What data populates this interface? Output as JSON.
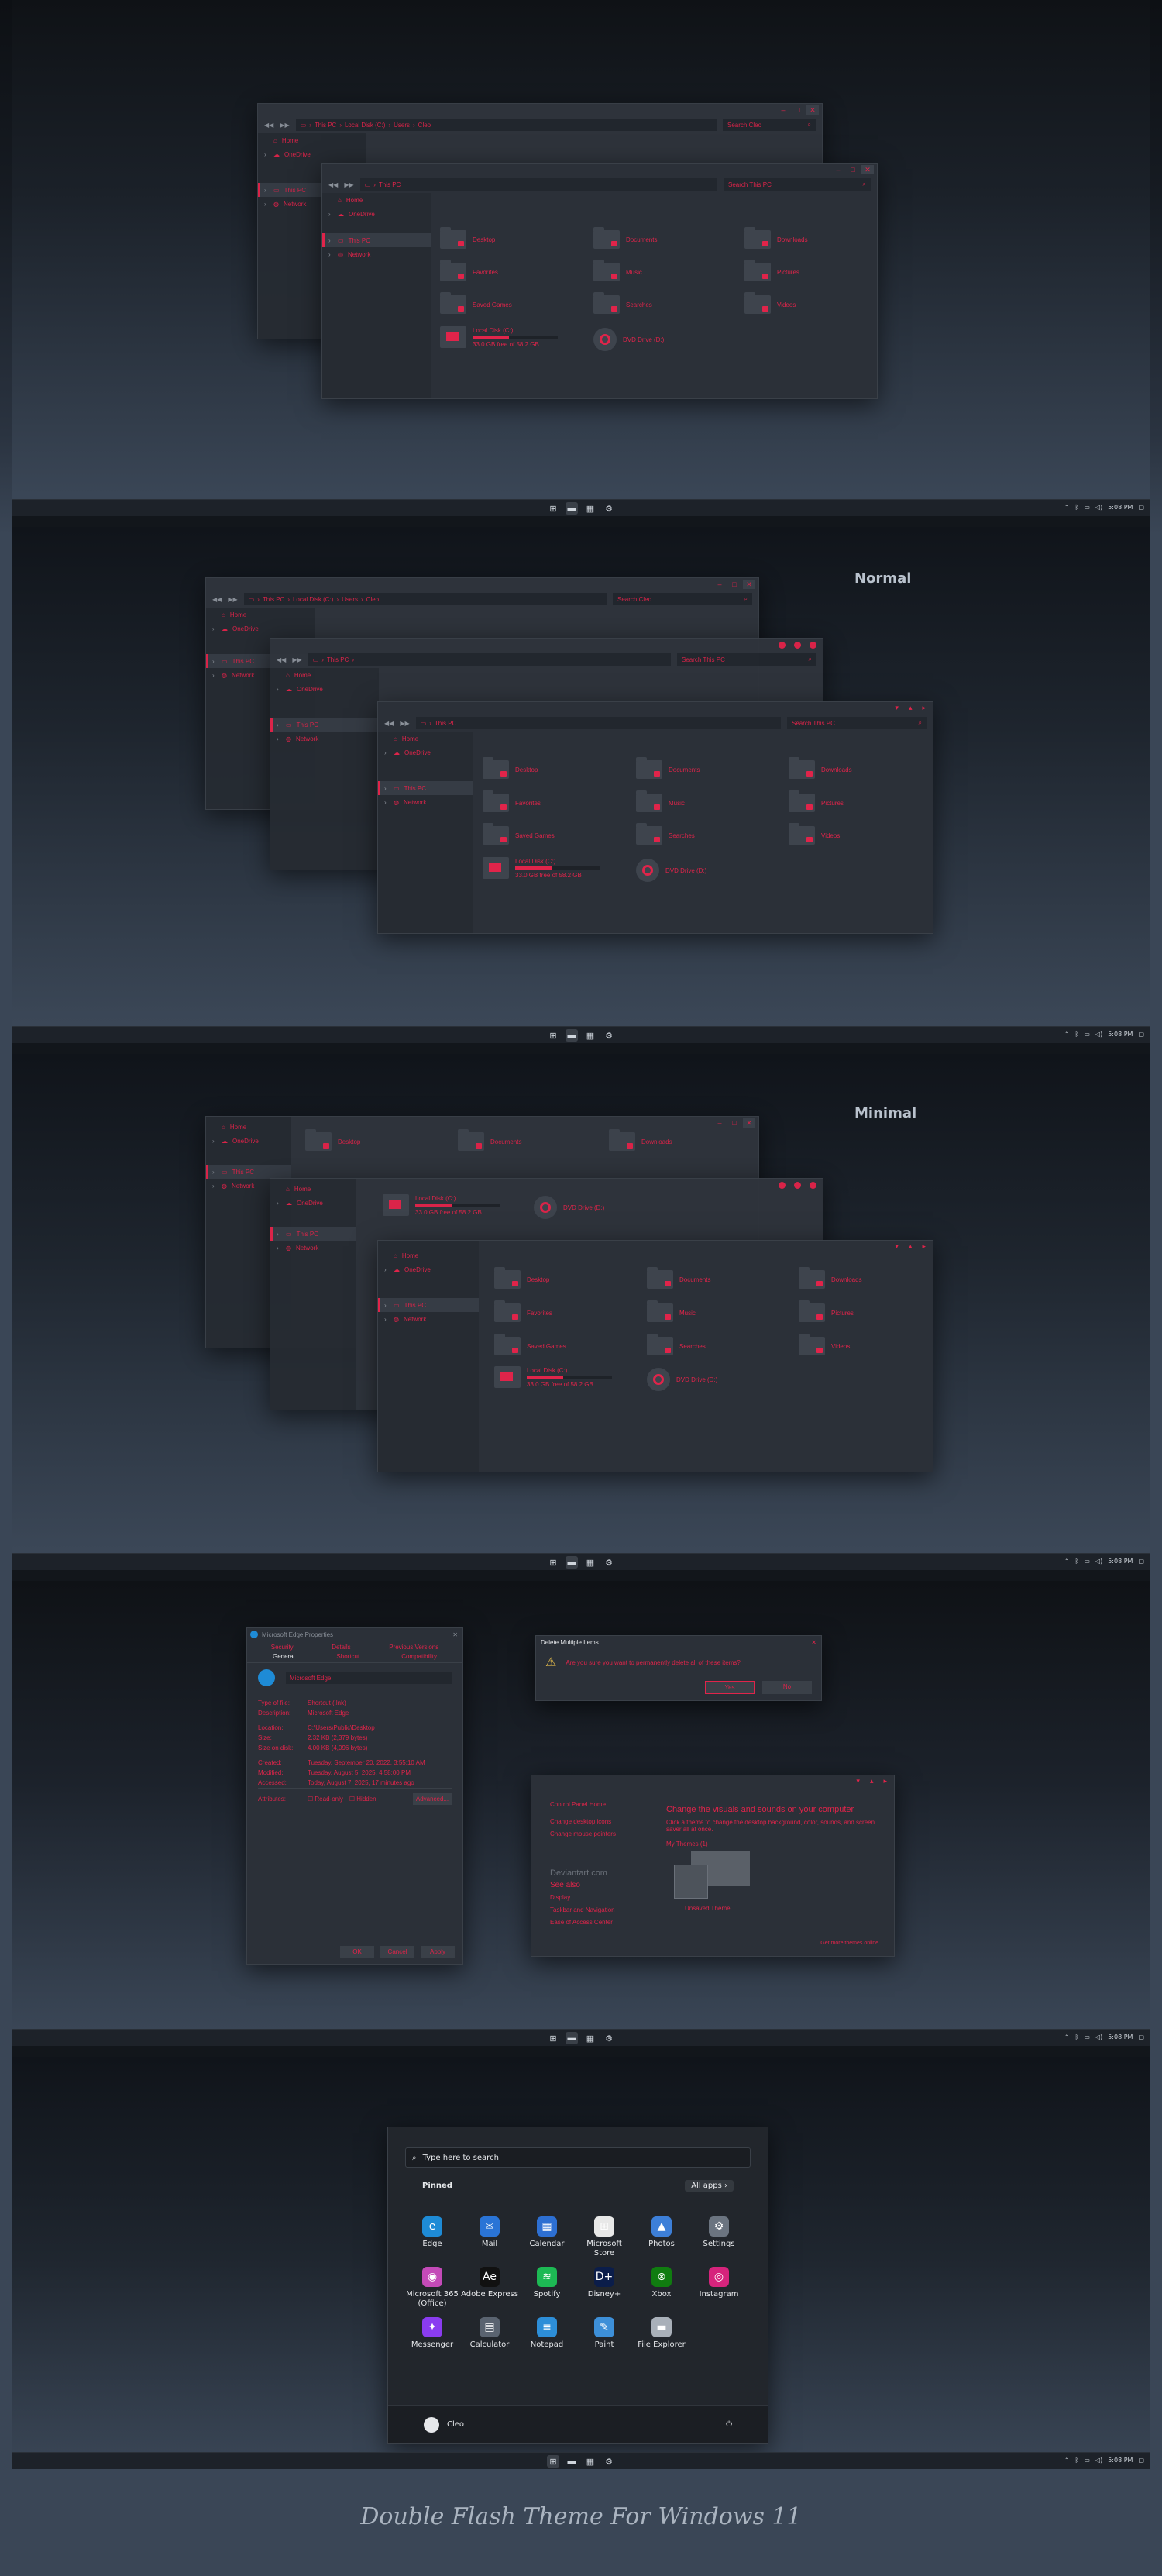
{
  "colors": {
    "accent": "#e0244a",
    "window": "#2b3038",
    "taskbar": "#1d2229",
    "text_light": "#e6e8eb"
  },
  "icons": {
    "taskbar": [
      "start-icon",
      "explorer-icon",
      "store-icon",
      "settings-icon"
    ],
    "tray": [
      "chevron-up-icon",
      "bluetooth-icon",
      "network-icon",
      "volume-icon",
      "notification-icon"
    ]
  },
  "taskbar": {
    "time": "5:08 PM"
  },
  "explorer": {
    "path_users": [
      "This PC",
      "Local Disk (C:)",
      "Users",
      "Cleo"
    ],
    "path_pc": [
      "This PC"
    ],
    "search_users": "Search Cleo",
    "search_pc": "Search This PC",
    "nav": {
      "home": "Home",
      "onedrive": "OneDrive",
      "thispc": "This PC",
      "network": "Network"
    },
    "folders": [
      "Desktop",
      "Documents",
      "Downloads",
      "Favorites",
      "Music",
      "Pictures",
      "Saved Games",
      "Searches",
      "Videos"
    ],
    "drive_c": {
      "name": "Local Disk (C:)",
      "free": "33.0 GB free of 58.2 GB",
      "used_fraction": 0.43
    },
    "drive_d": {
      "name": "DVD Drive (D:)"
    }
  },
  "labels": {
    "normal": "Normal",
    "minimal": "Minimal"
  },
  "props": {
    "title": "Microsoft Edge Properties",
    "tabs_top": [
      "Security",
      "Details",
      "Previous Versions"
    ],
    "tabs_bottom": [
      "General",
      "Shortcut",
      "Compatibility"
    ],
    "name": "Microsoft Edge",
    "rows": [
      {
        "k": "Type of file:",
        "v": "Shortcut (.lnk)"
      },
      {
        "k": "Description:",
        "v": "Microsoft Edge"
      },
      {
        "k": "Location:",
        "v": "C:\\Users\\Public\\Desktop"
      },
      {
        "k": "Size:",
        "v": "2.32 KB (2,379 bytes)"
      },
      {
        "k": "Size on disk:",
        "v": "4.00 KB (4,096 bytes)"
      },
      {
        "k": "Created:",
        "v": "Tuesday, September 20, 2022, 3:55:10 AM"
      },
      {
        "k": "Modified:",
        "v": "Tuesday, August 5, 2025, 4:58:00 PM"
      },
      {
        "k": "Accessed:",
        "v": "Today, August 7, 2025, 17 minutes ago"
      }
    ],
    "attributes": "Attributes:",
    "readonly": "Read-only",
    "hidden": "Hidden",
    "advanced": "Advanced...",
    "ok": "OK",
    "cancel": "Cancel",
    "apply": "Apply"
  },
  "delete": {
    "title": "Delete Multiple Items",
    "message": "Are you sure you want to permanently delete all of these items?",
    "yes": "Yes",
    "no": "No"
  },
  "cp": {
    "home": "Control Panel Home",
    "links": [
      "Change desktop icons",
      "Change mouse pointers"
    ],
    "watermark": "Deviantart.com",
    "see_also": "See also",
    "also_links": [
      "Display",
      "Taskbar and Navigation",
      "Ease of Access Center"
    ],
    "heading": "Change the visuals and sounds on your computer",
    "desc": "Click a theme to change the desktop background, color, sounds, and screen saver all at once.",
    "my_themes": "My Themes (1)",
    "unsaved": "Unsaved Theme",
    "more": "Get more themes online"
  },
  "start": {
    "search": "Type here to search",
    "pinned": "Pinned",
    "all_apps": "All apps",
    "apps": [
      {
        "name": "Edge",
        "icon": "edge-icon",
        "color": "#1e8bd6"
      },
      {
        "name": "Mail",
        "icon": "mail-icon",
        "color": "#2a74d6"
      },
      {
        "name": "Calendar",
        "icon": "calendar-icon",
        "color": "#2d6fd2"
      },
      {
        "name": "Microsoft Store",
        "icon": "store-icon",
        "color": "#e8e8e8"
      },
      {
        "name": "Photos",
        "icon": "photos-icon",
        "color": "#3d7fd8"
      },
      {
        "name": "Settings",
        "icon": "gear-icon",
        "color": "#6b7480"
      },
      {
        "name": "Microsoft 365 (Office)",
        "icon": "office-icon",
        "color": "#c44ab8"
      },
      {
        "name": "Adobe Express",
        "icon": "adobe-icon",
        "color": "#111111"
      },
      {
        "name": "Spotify",
        "icon": "spotify-icon",
        "color": "#1db954"
      },
      {
        "name": "Disney+",
        "icon": "disney-icon",
        "color": "#0b1d4a"
      },
      {
        "name": "Xbox",
        "icon": "xbox-icon",
        "color": "#107c10"
      },
      {
        "name": "Instagram",
        "icon": "instagram-icon",
        "color": "#d6247c"
      },
      {
        "name": "Messenger",
        "icon": "messenger-icon",
        "color": "#8a3cf0"
      },
      {
        "name": "Calculator",
        "icon": "calculator-icon",
        "color": "#5a6370"
      },
      {
        "name": "Notepad",
        "icon": "notepad-icon",
        "color": "#2d8ed8"
      },
      {
        "name": "Paint",
        "icon": "paint-icon",
        "color": "#3d8fd8"
      },
      {
        "name": "File Explorer",
        "icon": "folder-icon",
        "color": "#a9b0b9"
      }
    ],
    "user": "Cleo"
  },
  "footer": "Double Flash Theme For Windows 11"
}
